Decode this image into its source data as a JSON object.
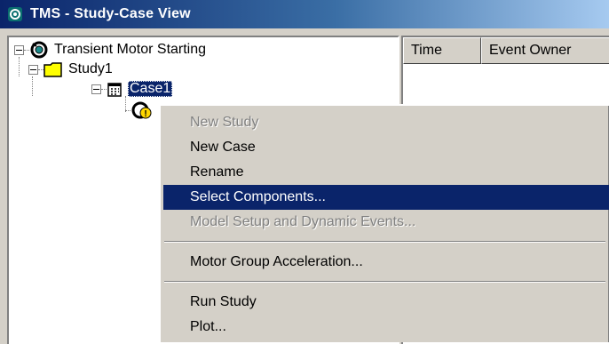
{
  "window": {
    "title": "TMS - Study-Case View",
    "app_icon": "tms-gear-icon"
  },
  "tree": {
    "root": {
      "label": "Transient Motor Starting",
      "icon": "tms-gear-icon"
    },
    "study": {
      "label": "Study1",
      "icon": "folder-icon"
    },
    "case": {
      "label": "Case1",
      "icon": "calendar-icon"
    },
    "child": {
      "icon": "motor-event-icon"
    }
  },
  "event_list": {
    "columns": [
      "Time",
      "Event Owner"
    ]
  },
  "context_menu": {
    "items": [
      {
        "label": "New Study",
        "enabled": false
      },
      {
        "label": "New Case",
        "enabled": true
      },
      {
        "label": "Rename",
        "enabled": true
      },
      {
        "label": "Select Components...",
        "enabled": true,
        "highlighted": true
      },
      {
        "label": "Model Setup and Dynamic Events...",
        "enabled": false
      },
      {
        "label": "Motor Group Acceleration...",
        "enabled": true
      },
      {
        "label": "Run Study",
        "enabled": true
      },
      {
        "label": "Plot...",
        "enabled": true
      }
    ]
  },
  "colors": {
    "selection": "#0a246a",
    "face": "#d4d0c8",
    "disabled_text": "#808080"
  }
}
